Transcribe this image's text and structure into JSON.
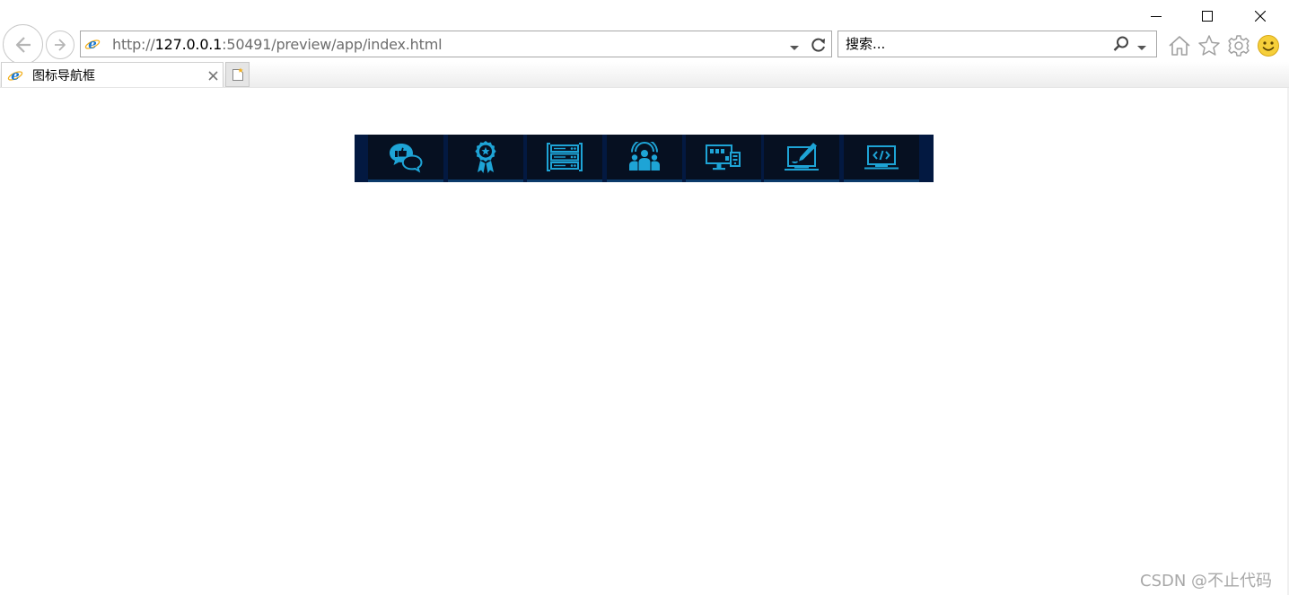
{
  "browser": {
    "address": {
      "url_scheme": "http://",
      "url_host": "127.0.0.1",
      "url_rest": ":50491/preview/app/index.html"
    },
    "search": {
      "placeholder": "搜索..."
    },
    "tabs": [
      {
        "title": "图标导航框",
        "active": true
      }
    ],
    "icons": {
      "back": "arrow-left-icon",
      "forward": "arrow-right-icon",
      "page": "ie-icon",
      "refresh": "refresh-icon",
      "search": "search-icon",
      "home": "home-icon",
      "favorites": "star-icon",
      "tools": "gear-icon",
      "feedback": "smiley-icon"
    }
  },
  "page": {
    "nav_items": [
      {
        "icon": "chat-like-icon"
      },
      {
        "icon": "award-ribbon-icon"
      },
      {
        "icon": "server-rack-icon"
      },
      {
        "icon": "team-people-icon"
      },
      {
        "icon": "multi-device-icon"
      },
      {
        "icon": "laptop-design-icon"
      },
      {
        "icon": "laptop-code-icon"
      }
    ],
    "colors": {
      "navbar_bg": "#031941",
      "item_bg": "#061021",
      "icon_color": "#1ea4d6",
      "item_border": "#0b3a6a"
    }
  },
  "watermark": "CSDN @不止代码"
}
